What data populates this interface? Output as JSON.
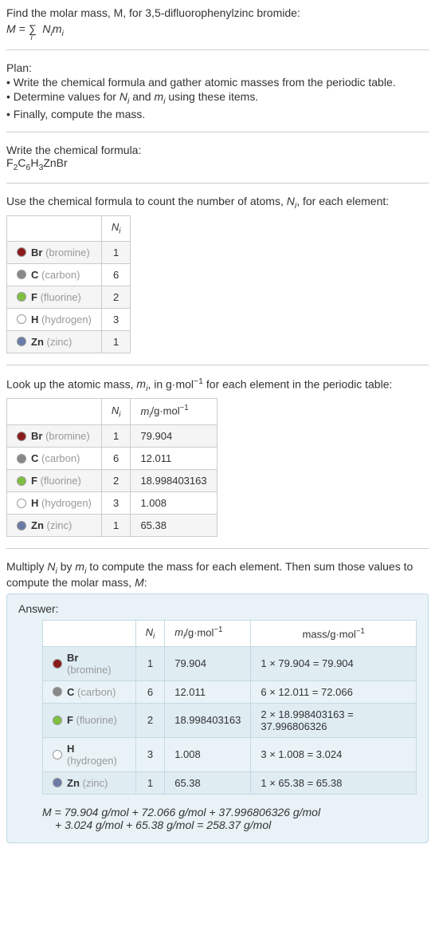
{
  "intro": "Find the molar mass, M, for 3,5-difluorophenylzinc bromide:",
  "formula": "M = ∑ Nᵢmᵢ",
  "formula_sub": "i",
  "plan_header": "Plan:",
  "plan": [
    "• Write the chemical formula and gather atomic masses from the periodic table.",
    "• Determine values for Nᵢ and mᵢ using these items.",
    "• Finally, compute the mass."
  ],
  "write_formula_label": "Write the chemical formula:",
  "chem_formula": "F₂C₆H₃ZnBr",
  "count_atoms_text": "Use the chemical formula to count the number of atoms, Nᵢ, for each element:",
  "col_Ni": "Nᵢ",
  "col_mi": "mᵢ/g·mol⁻¹",
  "col_mass": "mass/g·mol⁻¹",
  "elements": [
    {
      "sym": "Br",
      "name": "(bromine)",
      "color": "#8B1A1A",
      "n": "1",
      "m": "79.904",
      "mass": "1 × 79.904 = 79.904"
    },
    {
      "sym": "C",
      "name": "(carbon)",
      "color": "#888888",
      "n": "6",
      "m": "12.011",
      "mass": "6 × 12.011 = 72.066"
    },
    {
      "sym": "F",
      "name": "(fluorine)",
      "color": "#7FBF3F",
      "n": "2",
      "m": "18.998403163",
      "mass": "2 × 18.998403163 = 37.996806326"
    },
    {
      "sym": "H",
      "name": "(hydrogen)",
      "color": "#FFFFFF",
      "n": "3",
      "m": "1.008",
      "mass": "3 × 1.008 = 3.024"
    },
    {
      "sym": "Zn",
      "name": "(zinc)",
      "color": "#6B7BA8",
      "n": "1",
      "m": "65.38",
      "mass": "1 × 65.38 = 65.38"
    }
  ],
  "lookup_text": "Look up the atomic mass, mᵢ, in g·mol⁻¹ for each element in the periodic table:",
  "multiply_text": "Multiply Nᵢ by mᵢ to compute the mass for each element. Then sum those values to compute the molar mass, M:",
  "answer_label": "Answer:",
  "final1": "M = 79.904 g/mol + 72.066 g/mol + 37.996806326 g/mol",
  "final2": "+ 3.024 g/mol + 65.38 g/mol = 258.37 g/mol"
}
